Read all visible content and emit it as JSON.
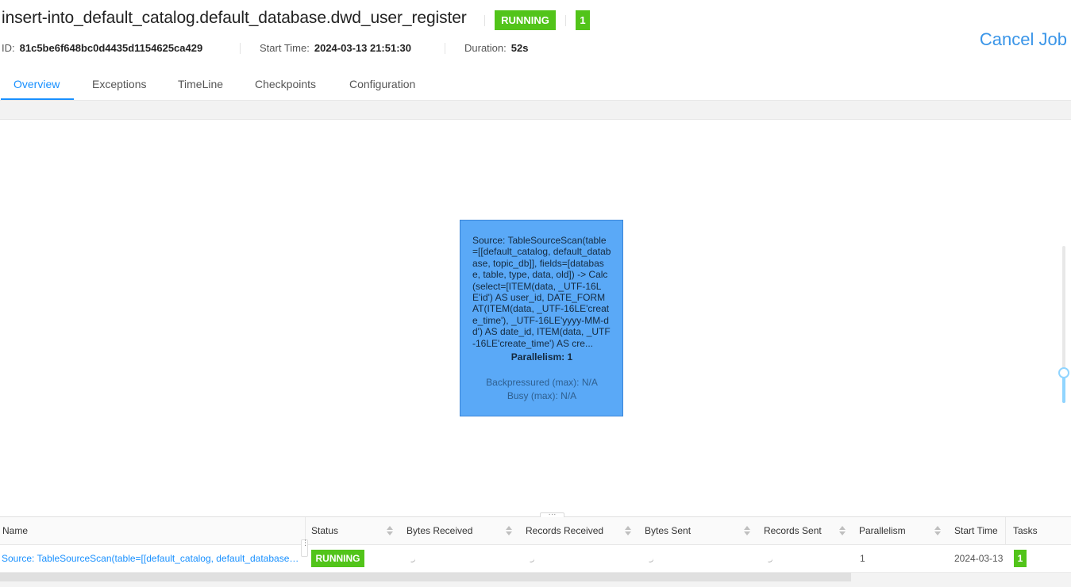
{
  "header": {
    "job_name": "insert-into_default_catalog.default_database.dwd_user_register",
    "status": "RUNNING",
    "task_count": "1",
    "id_label": "ID:",
    "id_value": "81c5be6f648bc0d4435d1154625ca429",
    "start_time_label": "Start Time:",
    "start_time_value": "2024-03-13 21:51:30",
    "duration_label": "Duration:",
    "duration_value": "52s",
    "cancel_label": "Cancel Job"
  },
  "tabs": [
    {
      "label": "Overview",
      "active": true
    },
    {
      "label": "Exceptions"
    },
    {
      "label": "TimeLine"
    },
    {
      "label": "Checkpoints"
    },
    {
      "label": "Configuration"
    }
  ],
  "graph": {
    "node": {
      "description": "Source: TableSourceScan(table=[[default_catalog, default_database, topic_db]], fields=[database, table, type, data, old]) -> Calc(select=[ITEM(data, _UTF-16LE'id') AS user_id, DATE_FORMAT(ITEM(data, _UTF-16LE'create_time'), _UTF-16LE'yyyy-MM-dd') AS date_id, ITEM(data, _UTF-16LE'create_time') AS cre...",
      "parallelism": "Parallelism: 1",
      "backpressured": "Backpressured (max): N/A",
      "busy": "Busy (max): N/A"
    }
  },
  "table": {
    "headers": {
      "name": "Name",
      "status": "Status",
      "bytes_received": "Bytes Received",
      "records_received": "Records Received",
      "bytes_sent": "Bytes Sent",
      "records_sent": "Records Sent",
      "parallelism": "Parallelism",
      "start_time": "Start Time",
      "tasks": "Tasks"
    },
    "rows": [
      {
        "name": "Source: TableSourceScan(table=[[default_catalog, default_database, topic_db]], fields=[database, table, type, data, old]) -> Calc(...)",
        "status": "RUNNING",
        "parallelism": "1",
        "start_time": "2024-03-13",
        "tasks": "1"
      }
    ]
  },
  "colors": {
    "running": "#52c41a",
    "accent": "#1890ff",
    "node_fill": "#5aa9f7",
    "cancel": "#3a95e8"
  }
}
